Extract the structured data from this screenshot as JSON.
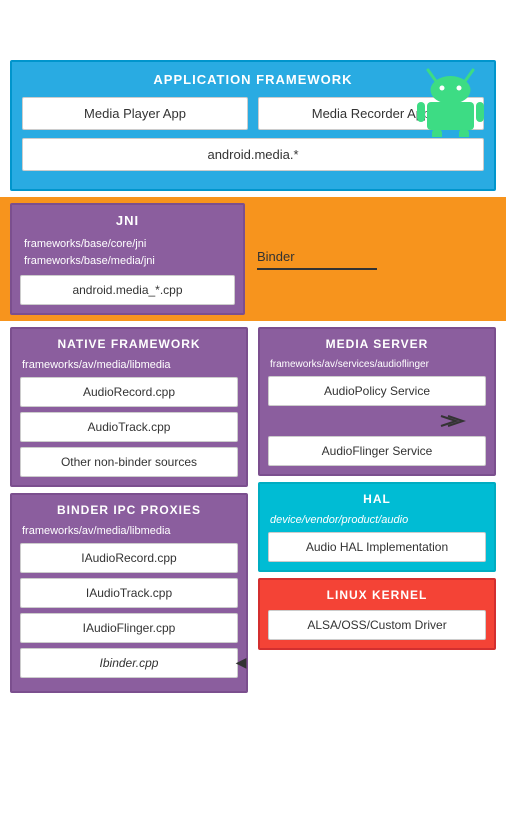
{
  "android_icon": {
    "color": "#3DDC84",
    "body_color": "#3DDC84"
  },
  "app_framework": {
    "title": "APPLICATION FRAMEWORK",
    "media_player": "Media Player App",
    "media_recorder": "Media Recorder App",
    "android_media": "android.media.*"
  },
  "jni": {
    "title": "JNI",
    "path1": "frameworks/base/core/jni",
    "path2": "frameworks/base/media/jni",
    "cpp": "android.media_*.cpp"
  },
  "binder": {
    "label": "Binder"
  },
  "native_framework": {
    "title": "NATIVE FRAMEWORK",
    "path": "frameworks/av/media/libmedia",
    "items": [
      "AudioRecord.cpp",
      "AudioTrack.cpp",
      "Other non-binder sources"
    ]
  },
  "media_server": {
    "title": "MEDIA SERVER",
    "path": "frameworks/av/services/audioflinger",
    "items": [
      "AudioPolicy Service",
      "AudioFlinger Service"
    ]
  },
  "binder_ipc": {
    "title": "BINDER IPC PROXIES",
    "path": "frameworks/av/media/libmedia",
    "items": [
      "IAudioRecord.cpp",
      "IAudioTrack.cpp",
      "IAudioFlinger.cpp",
      "Ibinder.cpp"
    ]
  },
  "hal": {
    "title": "HAL",
    "path": "device/vendor/product/audio",
    "items": [
      "Audio HAL Implementation"
    ]
  },
  "linux_kernel": {
    "title": "LINUX KERNEL",
    "items": [
      "ALSA/OSS/Custom Driver"
    ]
  }
}
